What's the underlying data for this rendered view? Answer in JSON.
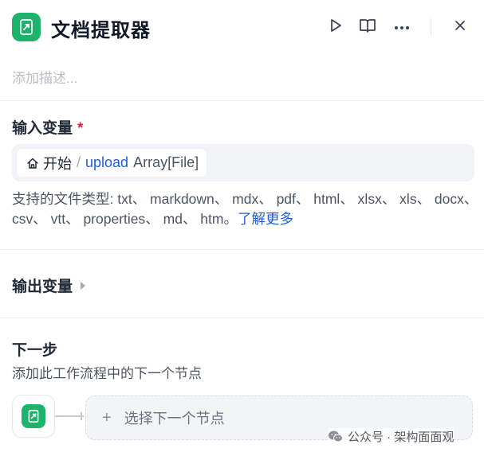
{
  "header": {
    "title": "文档提取器",
    "description_placeholder": "添加描述..."
  },
  "input_section": {
    "title": "输入变量",
    "required_mark": "*",
    "variable": {
      "node": "开始",
      "separator": "/",
      "name": "upload",
      "type": "Array[File]"
    },
    "support_text": "支持的文件类型: txt、 markdown、 mdx、 pdf、 html、 xlsx、 xls、 docx、 csv、 vtt、 properties、 md、 htm。",
    "learn_more": "了解更多"
  },
  "output_section": {
    "title": "输出变量"
  },
  "next_step": {
    "title": "下一步",
    "subtitle": "添加此工作流程中的下一个节点",
    "select_label": "选择下一个节点",
    "plus": "+"
  },
  "watermark": {
    "text": "公众号 · 架构面面观"
  },
  "icons": {
    "app": "document-extractor-icon",
    "play": "play-icon",
    "book": "book-open-icon",
    "more": "more-horizontal-icon",
    "close": "close-icon",
    "home": "home-icon",
    "chevron": "chevron-right-icon",
    "wechat": "wechat-icon"
  },
  "colors": {
    "accent_green": "#1db36a",
    "link_blue": "#1d5fd6",
    "required_red": "#e11d48"
  }
}
